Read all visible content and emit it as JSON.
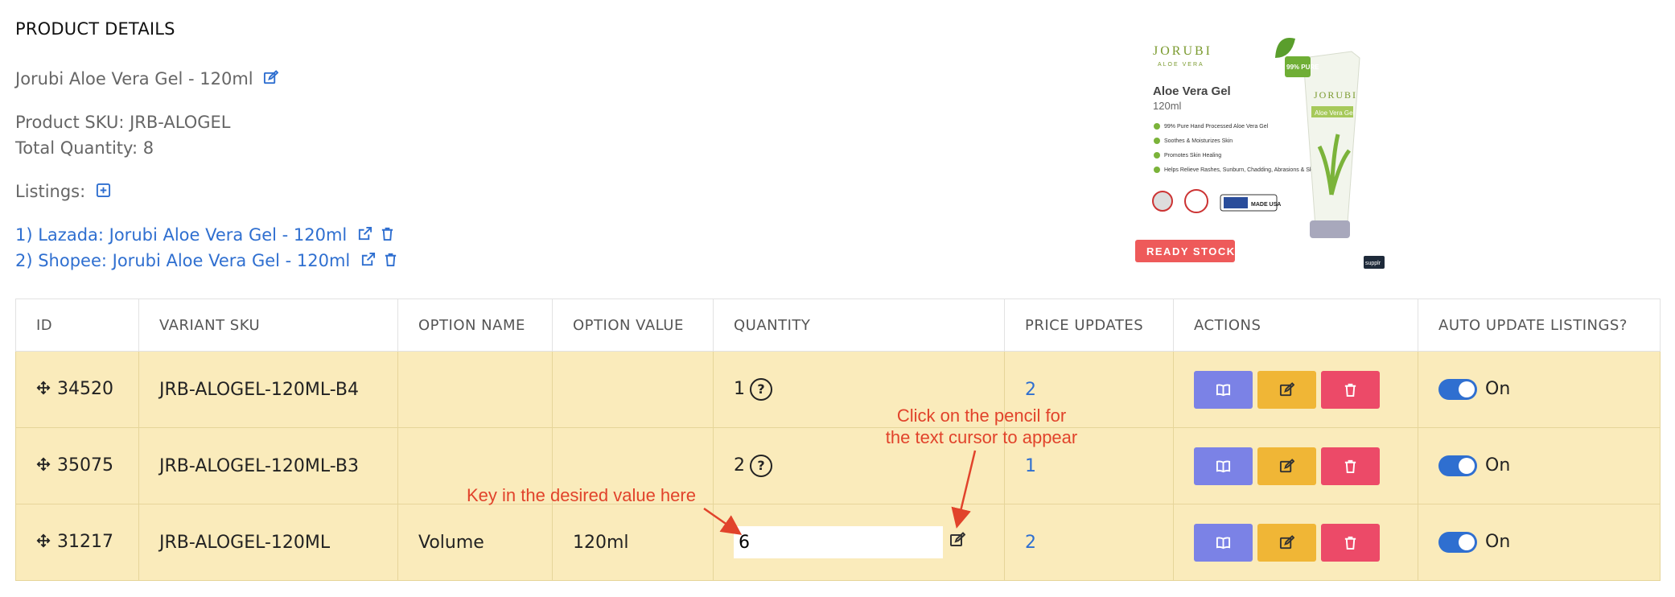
{
  "section_title": "PRODUCT DETAILS",
  "product": {
    "name": "Jorubi Aloe Vera Gel - 120ml",
    "sku_text": "Product SKU: JRB-ALOGEL",
    "total_qty_text": "Total Quantity: 8",
    "listings_label": "Listings:",
    "listings": [
      {
        "text": "1) Lazada: Jorubi Aloe Vera Gel - 120ml"
      },
      {
        "text": "2) Shopee: Jorubi Aloe Vera Gel - 120ml"
      }
    ]
  },
  "image": {
    "brand": "JORUBI",
    "brand_sub": "ALOE VERA",
    "title": "Aloe Vera Gel",
    "size": "120ml",
    "badge": "99% PURE",
    "bullets": [
      "99% Pure Hand Processed Aloe Vera Gel",
      "Soothes & Moisturizes Skin",
      "Promotes Skin Healing",
      "Helps Relieve Rashes, Sunburn, Chadding, Abrasions & Skin Irritations"
    ],
    "stock_label": "READY STOCK",
    "corner_tag": "supplr",
    "usa_label": "MADE USA",
    "tube_label": "Aloe Vera Gel"
  },
  "table": {
    "headers": [
      "ID",
      "VARIANT SKU",
      "OPTION NAME",
      "OPTION VALUE",
      "QUANTITY",
      "PRICE UPDATES",
      "ACTIONS",
      "AUTO UPDATE LISTINGS?"
    ],
    "rows": [
      {
        "id": "34520",
        "sku": "JRB-ALOGEL-120ML-B4",
        "option_name": "",
        "option_value": "",
        "quantity": "1",
        "price_updates": "2",
        "auto": "On"
      },
      {
        "id": "35075",
        "sku": "JRB-ALOGEL-120ML-B3",
        "option_name": "",
        "option_value": "",
        "quantity": "2",
        "price_updates": "1",
        "auto": "On"
      },
      {
        "id": "31217",
        "sku": "JRB-ALOGEL-120ML",
        "option_name": "Volume",
        "option_value": "120ml",
        "quantity": "6",
        "price_updates": "2",
        "auto": "On"
      }
    ]
  },
  "annotations": {
    "pencil_note_line1": "Click on the pencil for",
    "pencil_note_line2": "the text cursor to appear",
    "key_note": "Key in the desired value here"
  },
  "colors": {
    "link": "#2f6fd0",
    "row_bg": "#faebbb",
    "btn_view": "#7b82e6",
    "btn_edit": "#f0b636",
    "btn_delete": "#ec4a68",
    "annotation": "#e1432b"
  }
}
